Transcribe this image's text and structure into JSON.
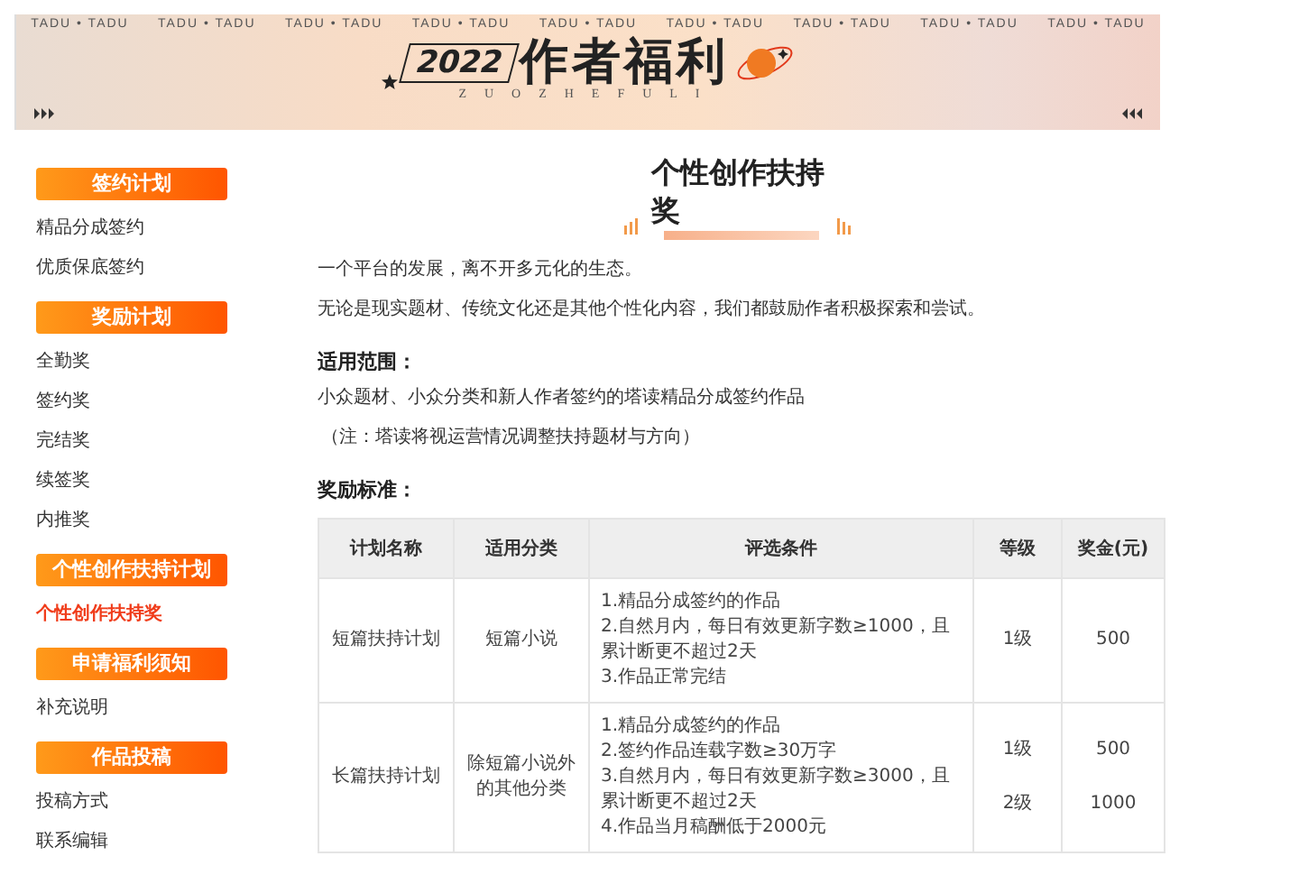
{
  "banner": {
    "tags": [
      "TADU • TADU",
      "TADU • TADU",
      "TADU • TADU",
      "TADU • TADU",
      "TADU • TADU",
      "TADU • TADU",
      "TADU • TADU",
      "TADU • TADU",
      "TADU • TADU"
    ],
    "year": "2022",
    "title": "作者福利",
    "subtitle": "ZUOZHEFULI"
  },
  "sidebar": {
    "sections": [
      {
        "title": "签约计划",
        "items": [
          {
            "label": "精品分成签约",
            "selected": false
          },
          {
            "label": "优质保底签约",
            "selected": false
          }
        ]
      },
      {
        "title": "奖励计划",
        "items": [
          {
            "label": "全勤奖",
            "selected": false
          },
          {
            "label": "签约奖",
            "selected": false
          },
          {
            "label": "完结奖",
            "selected": false
          },
          {
            "label": "续签奖",
            "selected": false
          },
          {
            "label": "内推奖",
            "selected": false
          }
        ]
      },
      {
        "title": "个性创作扶持计划",
        "items": [
          {
            "label": "个性创作扶持奖",
            "selected": true
          }
        ]
      },
      {
        "title": "申请福利须知",
        "items": [
          {
            "label": "补充说明",
            "selected": false
          }
        ]
      },
      {
        "title": "作品投稿",
        "items": [
          {
            "label": "投稿方式",
            "selected": false
          },
          {
            "label": "联系编辑",
            "selected": false
          }
        ]
      }
    ]
  },
  "article": {
    "title": "个性创作扶持奖",
    "paragraphs": [
      "一个平台的发展，离不开多元化的生态。",
      "无论是现实题材、传统文化还是其他个性化内容，我们都鼓励作者积极探索和尝试。"
    ],
    "scope": {
      "heading": "适用范围：",
      "lines": [
        "小众题材、小众分类和新人作者签约的塔读精品分成签约作品",
        "（注：塔读将视运营情况调整扶持题材与方向）"
      ]
    },
    "standards": {
      "heading": "奖励标准：",
      "table": {
        "columns": [
          "计划名称",
          "适用分类",
          "评选条件",
          "等级",
          "奖金(元)"
        ],
        "rows": [
          {
            "name": "短篇扶持计划",
            "category": "短篇小说",
            "criteria": [
              "1.精品分成签约的作品",
              "2.自然月内，每日有效更新字数≥1000，且累计断更不超过2天",
              "3.作品正常完结"
            ],
            "tiers": [
              {
                "level": "1级",
                "amount": "500"
              }
            ]
          },
          {
            "name": "长篇扶持计划",
            "category": "除短篇小说外的其他分类",
            "criteria": [
              "1.精品分成签约的作品",
              "2.签约作品连载字数≥30万字",
              "3.自然月内，每日有效更新字数≥3000，且累计断更不超过2天",
              "4.作品当月稿酬低于2000元"
            ],
            "tiers": [
              {
                "level": "1级",
                "amount": "500"
              },
              {
                "level": "2级",
                "amount": "1000"
              }
            ]
          }
        ]
      }
    }
  }
}
